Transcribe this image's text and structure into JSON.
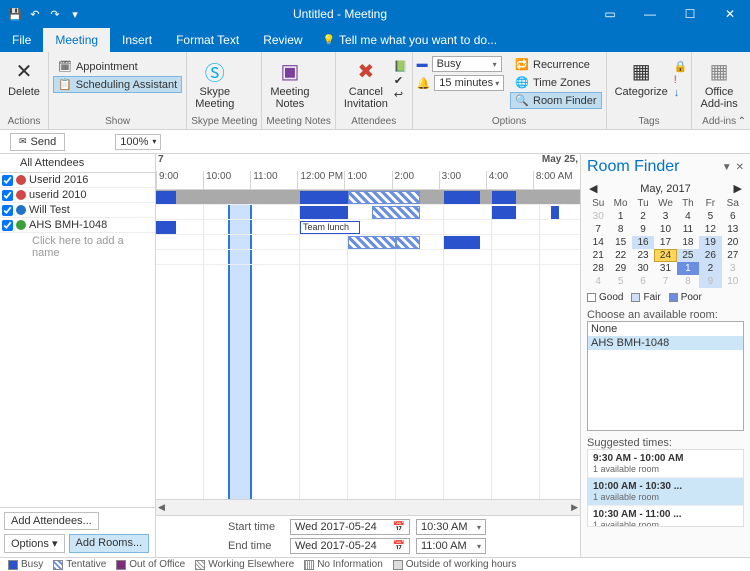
{
  "window": {
    "title": "Untitled - Meeting"
  },
  "qat": {
    "save": "💾",
    "undo": "↶",
    "redo": "↷",
    "more": "▾"
  },
  "tabs": {
    "file": "File",
    "meeting": "Meeting",
    "insert": "Insert",
    "format": "Format Text",
    "review": "Review",
    "tell": "Tell me what you want to do..."
  },
  "ribbon": {
    "actions": {
      "delete": "Delete",
      "group": "Actions"
    },
    "show": {
      "appointment": "Appointment",
      "scheduling": "Scheduling Assistant",
      "group": "Show"
    },
    "skype": {
      "label": "Skype\nMeeting",
      "group": "Skype Meeting"
    },
    "notes": {
      "label": "Meeting\nNotes",
      "group": "Meeting Notes"
    },
    "attendees": {
      "cancel": "Cancel\nInvitation",
      "group": "Attendees"
    },
    "options": {
      "showas_label": "Busy",
      "reminder": "15 minutes",
      "recurrence": "Recurrence",
      "timezones": "Time Zones",
      "roomfinder": "Room Finder",
      "group": "Options"
    },
    "tags": {
      "categorize": "Categorize",
      "group": "Tags"
    },
    "addins": {
      "label": "Office\nAdd-ins",
      "group": "Add-ins"
    }
  },
  "toolbar": {
    "send": "Send",
    "zoom": "100%"
  },
  "timeline": {
    "day1": "7",
    "day2": "May 25,",
    "hours": [
      "9:00",
      "10:00",
      "11:00",
      "12:00 PM",
      "1:00",
      "2:00",
      "3:00",
      "4:00",
      "8:00 AM"
    ],
    "team_lunch": "Team lunch"
  },
  "attendees": {
    "header": "All Attendees",
    "rows": [
      {
        "name": "Userid 2016",
        "color": "#d04848"
      },
      {
        "name": "userid 2010",
        "color": "#d04848"
      },
      {
        "name": "Will Test",
        "color": "#2173c7"
      },
      {
        "name": "AHS BMH-1048",
        "color": "#3aa03a"
      }
    ],
    "add": "Click here to add a name"
  },
  "buttons": {
    "add_attendees": "Add Attendees...",
    "options": "Options",
    "add_rooms": "Add Rooms..."
  },
  "time": {
    "start_label": "Start time",
    "start_date": "Wed 2017-05-24",
    "start_time": "10:30 AM",
    "end_label": "End time",
    "end_date": "Wed 2017-05-24",
    "end_time": "11:00 AM"
  },
  "legend": {
    "busy": "Busy",
    "tentative": "Tentative",
    "oof": "Out of Office",
    "elsewhere": "Working Elsewhere",
    "noinfo": "No Information",
    "outside": "Outside of working hours"
  },
  "roomfinder": {
    "title": "Room Finder",
    "month": "May, 2017",
    "dow": [
      "Su",
      "Mo",
      "Tu",
      "We",
      "Th",
      "Fr",
      "Sa"
    ],
    "weeks": [
      [
        {
          "n": 30,
          "c": "out"
        },
        {
          "n": 1
        },
        {
          "n": 2
        },
        {
          "n": 3
        },
        {
          "n": 4
        },
        {
          "n": 5
        },
        {
          "n": 6
        }
      ],
      [
        {
          "n": 7
        },
        {
          "n": 8
        },
        {
          "n": 9
        },
        {
          "n": 10
        },
        {
          "n": 11
        },
        {
          "n": 12
        },
        {
          "n": 13
        }
      ],
      [
        {
          "n": 14
        },
        {
          "n": 15
        },
        {
          "n": 16,
          "c": "fair"
        },
        {
          "n": 17
        },
        {
          "n": 18
        },
        {
          "n": 19,
          "c": "fair"
        },
        {
          "n": 20
        }
      ],
      [
        {
          "n": 21
        },
        {
          "n": 22
        },
        {
          "n": 23
        },
        {
          "n": 24,
          "c": "sel"
        },
        {
          "n": 25,
          "c": "fair"
        },
        {
          "n": 26,
          "c": "fair"
        },
        {
          "n": 27
        }
      ],
      [
        {
          "n": 28
        },
        {
          "n": 29
        },
        {
          "n": 30
        },
        {
          "n": 31
        },
        {
          "n": 1,
          "c": "poor"
        },
        {
          "n": 2,
          "c": "fair"
        },
        {
          "n": 3,
          "c": "out"
        }
      ],
      [
        {
          "n": 4,
          "c": "out"
        },
        {
          "n": 5,
          "c": "out"
        },
        {
          "n": 6,
          "c": "out"
        },
        {
          "n": 7,
          "c": "out"
        },
        {
          "n": 8,
          "c": "out"
        },
        {
          "n": 9,
          "c": "out fair"
        },
        {
          "n": 10,
          "c": "out"
        }
      ]
    ],
    "leg": {
      "good": "Good",
      "fair": "Fair",
      "poor": "Poor"
    },
    "choose": "Choose an available room:",
    "rooms": [
      "None",
      "AHS BMH-1048"
    ],
    "suggested_label": "Suggested times:",
    "suggested": [
      {
        "t": "9:30 AM - 10:00 AM",
        "s": "1 available room"
      },
      {
        "t": "10:00 AM - 10:30 ...",
        "s": "1 available room"
      },
      {
        "t": "10:30 AM - 11:00 ...",
        "s": "1 available room"
      }
    ]
  }
}
